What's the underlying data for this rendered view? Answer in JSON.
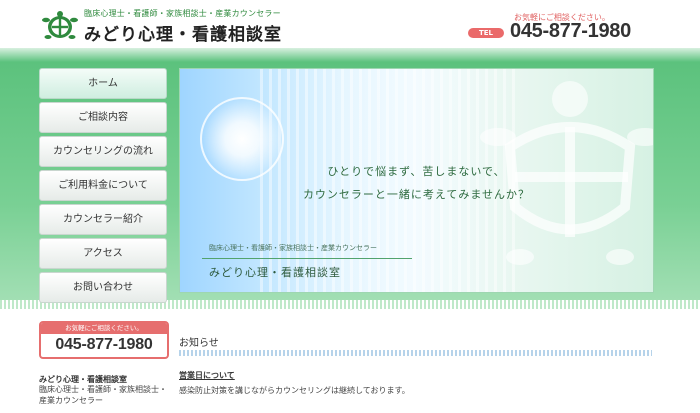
{
  "header": {
    "tagline": "臨床心理士・看護師・家族相談士・産業カウンセラー",
    "site_title": "みどり心理・看護相談室",
    "contact_note": "お気軽にご相談ください。",
    "tel_label": "TEL",
    "phone": "045-877-1980"
  },
  "nav": {
    "items": [
      {
        "label": "ホーム"
      },
      {
        "label": "ご相談内容"
      },
      {
        "label": "カウンセリングの流れ"
      },
      {
        "label": "ご利用料金について"
      },
      {
        "label": "カウンセラー紹介"
      },
      {
        "label": "アクセス"
      },
      {
        "label": "お問い合わせ"
      }
    ]
  },
  "hero": {
    "line1": "ひとりで悩まず、苦しまないで、",
    "line2": "カウンセラーと一緒に考えてみませんか？",
    "subtitle": "臨床心理士・看護師・家族相談士・産業カウンセラー",
    "name": "みどり心理・看護相談室"
  },
  "sidebar": {
    "contact_note": "お気軽にご相談ください。",
    "phone": "045-877-1980",
    "name": "みどり心理・看護相談室",
    "desc_line1": "臨床心理士・看護師・家族相談士・",
    "desc_line2": "産業カウンセラー"
  },
  "news": {
    "title": "お知らせ",
    "item_title": "営業日について",
    "item_text": "感染防止対策を講じながらカウンセリングは継続しております。"
  },
  "colors": {
    "brand_green": "#4cb86e",
    "accent_red": "#e66e6e"
  }
}
